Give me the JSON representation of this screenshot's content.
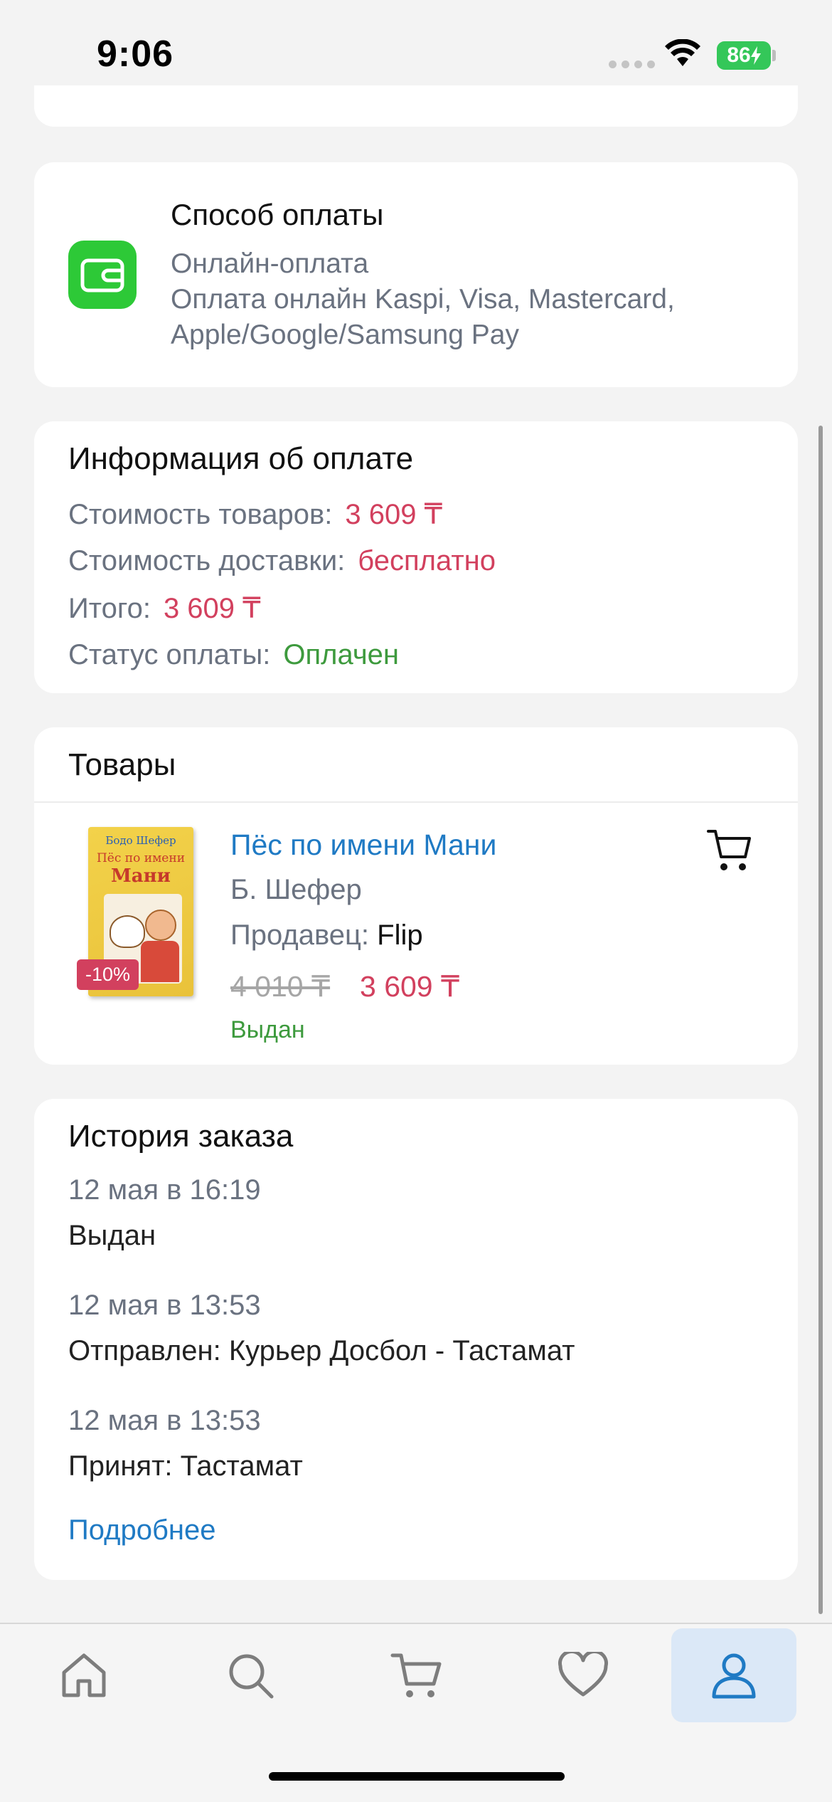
{
  "status_bar": {
    "time": "9:06",
    "battery": "86"
  },
  "payment_method": {
    "title": "Способ оплаты",
    "method": "Онлайн-оплата",
    "description": "Оплата онлайн Kaspi, Visa, Mastercard, Apple/Google/Samsung Pay",
    "icon": "wallet-icon"
  },
  "payment_info": {
    "title": "Информация об оплате",
    "rows": [
      {
        "label": "Стоимость товаров:",
        "value": "3 609 ₸"
      },
      {
        "label": "Стоимость доставки:",
        "value": "бесплатно"
      },
      {
        "label": "Итого:",
        "value": "3 609 ₸"
      },
      {
        "label": "Статус оплаты:",
        "value": "Оплачен"
      }
    ]
  },
  "goods": {
    "title": "Товары",
    "item": {
      "cover_author": "Бодо Шефер",
      "cover_title_line1": "Пёс по имени",
      "cover_title_line2": "Мани",
      "discount": "-10%",
      "name": "Пёс по имени Мани",
      "author": "Б. Шефер",
      "seller_label": "Продавец:",
      "seller": "Flip",
      "old_price": "4 010 ₸",
      "price": "3 609 ₸",
      "status": "Выдан"
    }
  },
  "history": {
    "title": "История заказа",
    "entries": [
      {
        "date": "12 мая в 16:19",
        "text": "Выдан"
      },
      {
        "date": "12 мая в 13:53",
        "text": "Отправлен: Курьер Досбол - Тастамат"
      },
      {
        "date": "12 мая в 13:53",
        "text": "Принят: Тастамат"
      }
    ],
    "more_link": "Подробнее"
  },
  "tab_bar": {
    "tabs": [
      {
        "icon": "home-icon"
      },
      {
        "icon": "search-icon"
      },
      {
        "icon": "cart-icon"
      },
      {
        "icon": "heart-icon"
      },
      {
        "icon": "profile-icon",
        "active": true
      }
    ]
  },
  "colors": {
    "accent_blue": "#1f7ac4",
    "price_red": "#d2405e",
    "success_green": "#3d9a3d",
    "wallet_green": "#2dc937"
  }
}
